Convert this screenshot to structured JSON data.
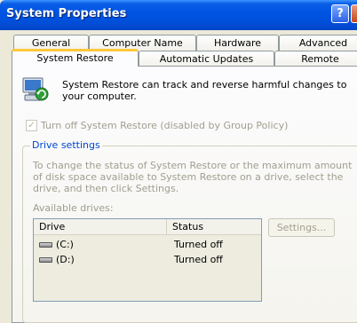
{
  "window": {
    "title": "System Properties"
  },
  "title_buttons": {
    "help": "?"
  },
  "tabs": {
    "row1": [
      "General",
      "Computer Name",
      "Hardware",
      "Advanced"
    ],
    "row2": [
      "System Restore",
      "Automatic Updates",
      "Remote"
    ],
    "active": "System Restore"
  },
  "intro_text": "System Restore can track and reverse harmful changes to your computer.",
  "checkbox": {
    "label": "Turn off System Restore (disabled by Group Policy)",
    "checked": true,
    "check_mark": "✓"
  },
  "drive_settings": {
    "legend": "Drive settings",
    "description": "To change the status of System Restore or the maximum amount of disk space available to System Restore on a drive, select the drive, and then click Settings.",
    "available_label": "Available drives:",
    "columns": {
      "drive": "Drive",
      "status": "Status"
    },
    "rows": [
      {
        "drive": "(C:)",
        "status": "Turned off"
      },
      {
        "drive": "(D:)",
        "status": "Turned off"
      }
    ],
    "settings_button": "Settings..."
  },
  "colors": {
    "titlebar": "#0054e3",
    "active_tab_accent": "#ffc83c",
    "group_legend": "#0046d5",
    "disabled_text": "#a19e8e"
  }
}
